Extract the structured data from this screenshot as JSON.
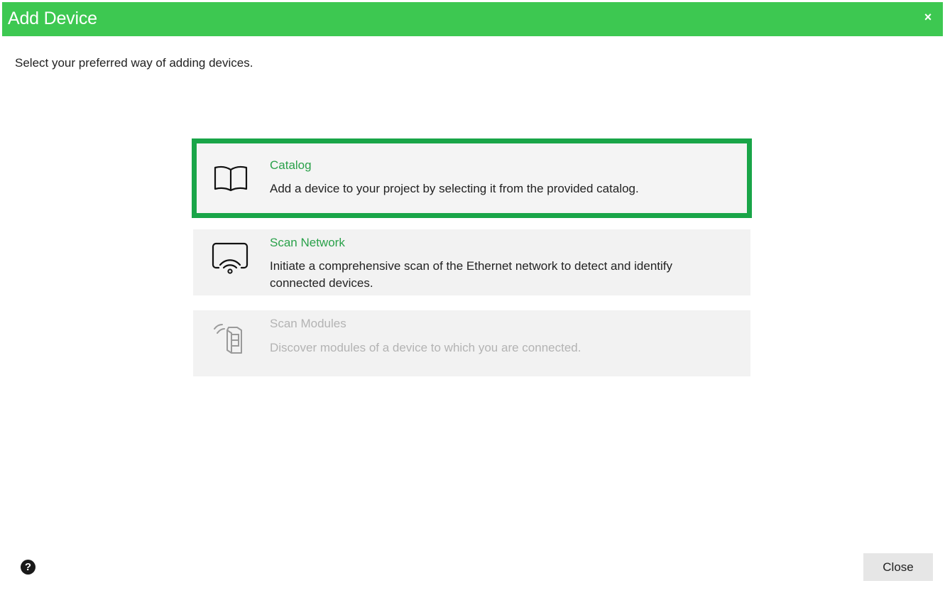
{
  "window": {
    "title": "Add Device",
    "close_glyph": "×"
  },
  "instruction": "Select your preferred way of adding devices.",
  "options": [
    {
      "title": "Catalog",
      "description": "Add a device to your project by selecting it from the provided catalog.",
      "icon": "book-icon",
      "state": "selected"
    },
    {
      "title": "Scan Network",
      "description": "Initiate a comprehensive scan of the Ethernet network to detect and identify connected devices.",
      "icon": "network-scan-icon",
      "state": "enabled"
    },
    {
      "title": "Scan Modules",
      "description": "Discover modules of a device to which you are connected.",
      "icon": "module-scan-icon",
      "state": "disabled"
    }
  ],
  "footer": {
    "help_glyph": "?",
    "close_label": "Close"
  },
  "colors": {
    "titlebar": "#3dc851",
    "selection_border": "#19a548",
    "option_title": "#2aa14a",
    "disabled_text": "#b3b3b3"
  }
}
